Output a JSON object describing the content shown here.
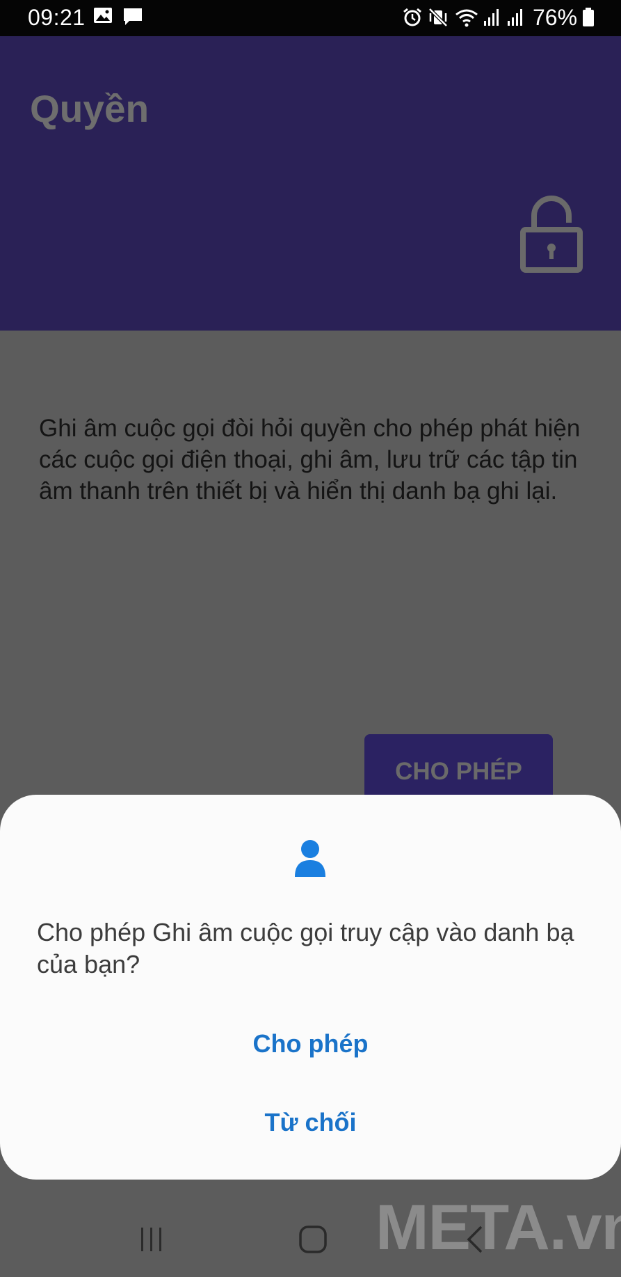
{
  "status_bar": {
    "time": "09:21",
    "battery": "76%",
    "icons": [
      "image-icon",
      "message-icon",
      "alarm-icon",
      "vibrate-mute-icon",
      "wifi-icon",
      "signal-icon",
      "signal-icon",
      "battery-icon"
    ]
  },
  "header": {
    "title": "Quyền",
    "icon": "lock-icon",
    "background": "#2a2156"
  },
  "content": {
    "description": "Ghi âm cuộc gọi đòi hỏi quyền cho phép phát hiện các cuộc gọi điện thoại, ghi âm, lưu trữ các tập tin âm thanh trên thiết bị và hiển thị danh bạ ghi lại.",
    "allow_button": "CHO PHÉP"
  },
  "dialog": {
    "icon": "person-icon",
    "message": "Cho phép Ghi âm cuộc gọi truy cập vào danh bạ của bạn?",
    "allow_label": "Cho phép",
    "deny_label": "Từ chối",
    "accent": "#1a73c9"
  },
  "nav_bar": {
    "items": [
      "recent-apps-icon",
      "home-icon",
      "back-icon"
    ]
  },
  "watermark": "META.vn"
}
